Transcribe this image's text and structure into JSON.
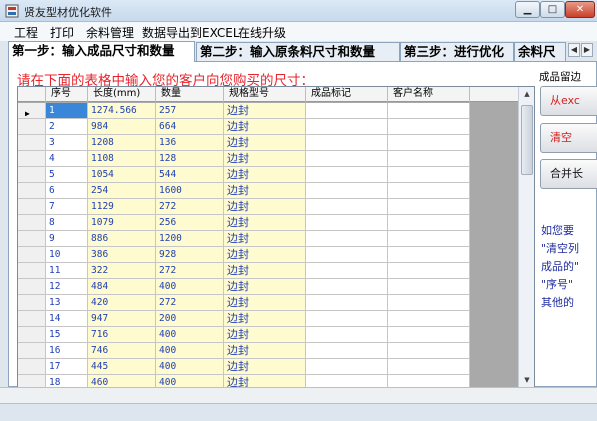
{
  "window": {
    "title": "贤友型材优化软件"
  },
  "menu": {
    "items": [
      "工程",
      "打印",
      "余料管理",
      "数据导出到EXCEL",
      "在线升级"
    ]
  },
  "tabs": [
    {
      "label": "第一步：输入成品尺寸和数量",
      "active": true
    },
    {
      "label": "第二步：输入原条料尺寸和数量",
      "active": false
    },
    {
      "label": "第三步：进行优化",
      "active": false
    },
    {
      "label": "余料尺",
      "active": false
    }
  ],
  "instruction": "请在下面的表格中输入您的客户向您购买的尺寸：",
  "grid": {
    "columns": [
      "序号",
      "长度(mm)",
      "数量",
      "规格型号",
      "成品标记",
      "客户名称"
    ],
    "rows": [
      {
        "seq": "1",
        "length": "1274.566",
        "qty": "257",
        "spec": "边封"
      },
      {
        "seq": "2",
        "length": "984",
        "qty": "664",
        "spec": "边封"
      },
      {
        "seq": "3",
        "length": "1208",
        "qty": "136",
        "spec": "边封"
      },
      {
        "seq": "4",
        "length": "1108",
        "qty": "128",
        "spec": "边封"
      },
      {
        "seq": "5",
        "length": "1054",
        "qty": "544",
        "spec": "边封"
      },
      {
        "seq": "6",
        "length": "254",
        "qty": "1600",
        "spec": "边封"
      },
      {
        "seq": "7",
        "length": "1129",
        "qty": "272",
        "spec": "边封"
      },
      {
        "seq": "8",
        "length": "1079",
        "qty": "256",
        "spec": "边封"
      },
      {
        "seq": "9",
        "length": "886",
        "qty": "1200",
        "spec": "边封"
      },
      {
        "seq": "10",
        "length": "386",
        "qty": "928",
        "spec": "边封"
      },
      {
        "seq": "11",
        "length": "322",
        "qty": "272",
        "spec": "边封"
      },
      {
        "seq": "12",
        "length": "484",
        "qty": "400",
        "spec": "边封"
      },
      {
        "seq": "13",
        "length": "420",
        "qty": "272",
        "spec": "边封"
      },
      {
        "seq": "14",
        "length": "947",
        "qty": "200",
        "spec": "边封"
      },
      {
        "seq": "15",
        "length": "716",
        "qty": "400",
        "spec": "边封"
      },
      {
        "seq": "16",
        "length": "746",
        "qty": "400",
        "spec": "边封"
      },
      {
        "seq": "17",
        "length": "445",
        "qty": "400",
        "spec": "边封"
      },
      {
        "seq": "18",
        "length": "460",
        "qty": "400",
        "spec": "边封"
      }
    ]
  },
  "side": {
    "label": "成品留边",
    "buttons": [
      {
        "label": "从exc",
        "color": "#d32020"
      },
      {
        "label": "清空",
        "color": "#d32020"
      },
      {
        "label": "合并长",
        "color": "#111111"
      }
    ],
    "hint_lines": [
      "如您要",
      "\"清空列",
      "成品的\"",
      "\"序号\"",
      "其他的"
    ]
  },
  "icons": {
    "app": "app-logo-icon",
    "minimize": "minimize-icon",
    "maximize": "maximize-icon",
    "close": "close-icon",
    "row_pointer": "row-pointer-icon"
  }
}
